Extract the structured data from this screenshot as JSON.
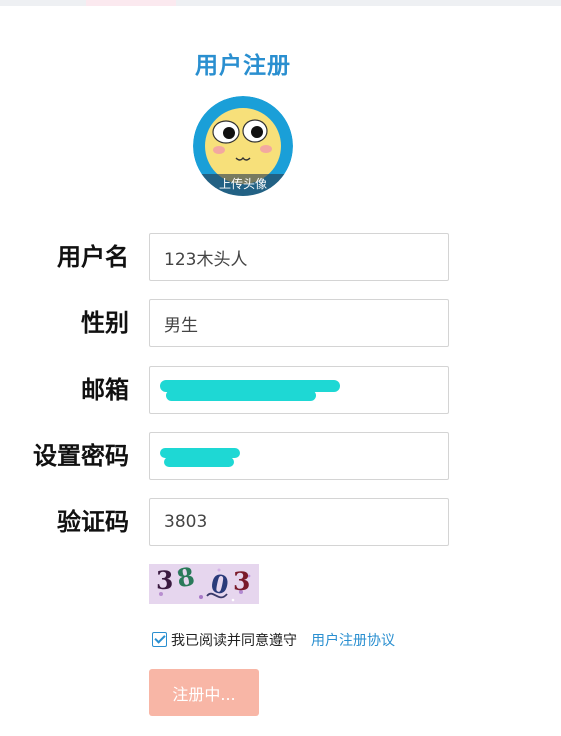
{
  "page": {
    "title": "用户注册"
  },
  "avatar": {
    "label": "上传头像"
  },
  "form": {
    "username": {
      "label": "用户名",
      "value": "123木头人"
    },
    "gender": {
      "label": "性别",
      "value": "男生"
    },
    "email": {
      "label": "邮箱",
      "value": ""
    },
    "password": {
      "label": "设置密码",
      "value": ""
    },
    "captcha": {
      "label": "验证码",
      "value": "3803"
    }
  },
  "captcha_image": {
    "chars": [
      "3",
      "8",
      "0",
      "3"
    ],
    "colors": [
      "#3a1a40",
      "#2a7a5a",
      "#2a3a7a",
      "#7a1a2a"
    ]
  },
  "agreement": {
    "checked": true,
    "text": "我已阅读并同意遵守",
    "link": "用户注册协议"
  },
  "submit": {
    "label": "注册中..."
  },
  "colors": {
    "accent": "#2a8fd0",
    "submit_bg": "#f8b6a6",
    "redaction": "#1ed8d4"
  }
}
